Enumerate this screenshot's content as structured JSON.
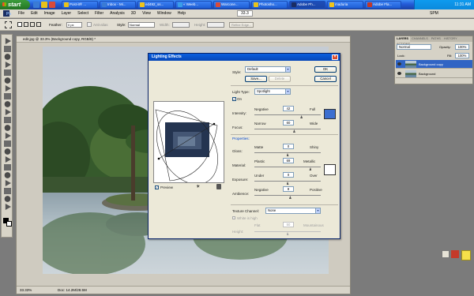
{
  "taskbar": {
    "start_label": "start",
    "tasks": [
      {
        "label": "Post-it® ...",
        "color": "#e8c21a"
      },
      {
        "label": "Inbox - Mi...",
        "color": "#3a7bd5"
      },
      {
        "label": "ed492_ss...",
        "color": "#f0c419"
      },
      {
        "label": "« Weeb...",
        "color": "#3a9ee8"
      },
      {
        "label": "Warcone...",
        "color": "#d94a3a"
      },
      {
        "label": "Photosho...",
        "color": "#e8c21a"
      },
      {
        "label": "Adobe Ph...",
        "color": "#1a2d63"
      },
      {
        "label": "maduria",
        "color": "#f0c419"
      },
      {
        "label": "Adobe Fla...",
        "color": "#c0392b"
      }
    ],
    "clock": "11:31 AM"
  },
  "menubar": {
    "items": [
      "File",
      "Edit",
      "Image",
      "Layer",
      "Select",
      "Filter",
      "Analysis",
      "3D",
      "View",
      "Window",
      "Help"
    ],
    "zoom": "33.3",
    "workspace": "SPM"
  },
  "options_bar": {
    "feather_label": "Feather:",
    "feather_value": "0 px",
    "antialias_label": "Anti-alias",
    "style_label": "Style:",
    "style_value": "Normal",
    "width_label": "Width:",
    "height_label": "Height:",
    "refine_label": "Refine Edge..."
  },
  "document": {
    "title": "edit.jpg @ 33.3% (Background copy, RGB/8) *",
    "zoom": "33.33%",
    "doc_info": "Doc: 14.2M/28.5M"
  },
  "layers_panel": {
    "tabs": [
      "LAYERS",
      "CHANNELS",
      "PATHS",
      "HISTORY",
      "ACTIONS"
    ],
    "blend_mode": "Normal",
    "opacity_label": "Opacity:",
    "opacity": "100%",
    "lock_label": "Lock:",
    "fill_label": "Fill:",
    "fill": "100%",
    "layers": [
      {
        "name": "Background copy",
        "selected": true
      },
      {
        "name": "Background",
        "selected": false
      }
    ]
  },
  "dialog": {
    "title": "Lighting Effects",
    "style_label": "Style:",
    "style_value": "Default",
    "save_label": "Save...",
    "delete_label": "Delete",
    "ok_label": "OK",
    "cancel_label": "Cancel",
    "light_type_label": "Light Type:",
    "light_type_value": "Spotlight",
    "on_label": "On",
    "intensity_label": "Intensity:",
    "intensity_min": "Negative",
    "intensity_max": "Full",
    "intensity_value": "42",
    "focus_label": "Focus:",
    "focus_min": "Narrow",
    "focus_max": "Wide",
    "focus_value": "60",
    "properties_label": "Properties:",
    "gloss_label": "Gloss:",
    "gloss_min": "Matte",
    "gloss_max": "Shiny",
    "gloss_value": "0",
    "material_label": "Material:",
    "material_min": "Plastic",
    "material_max": "Metallic",
    "material_value": "69",
    "exposure_label": "Exposure:",
    "exposure_min": "Under",
    "exposure_max": "Over",
    "exposure_value": "0",
    "ambience_label": "Ambience:",
    "ambience_min": "Negative",
    "ambience_max": "Positive",
    "ambience_value": "8",
    "texture_label": "Texture Channel:",
    "texture_value": "None",
    "white_high_label": "White is high",
    "height_label": "Height:",
    "height_min": "Flat",
    "height_max": "Mountainous",
    "height_value": "50",
    "preview_label": "Preview",
    "light_color": "#3c6fd0",
    "ambience_color": "#ffffff"
  }
}
